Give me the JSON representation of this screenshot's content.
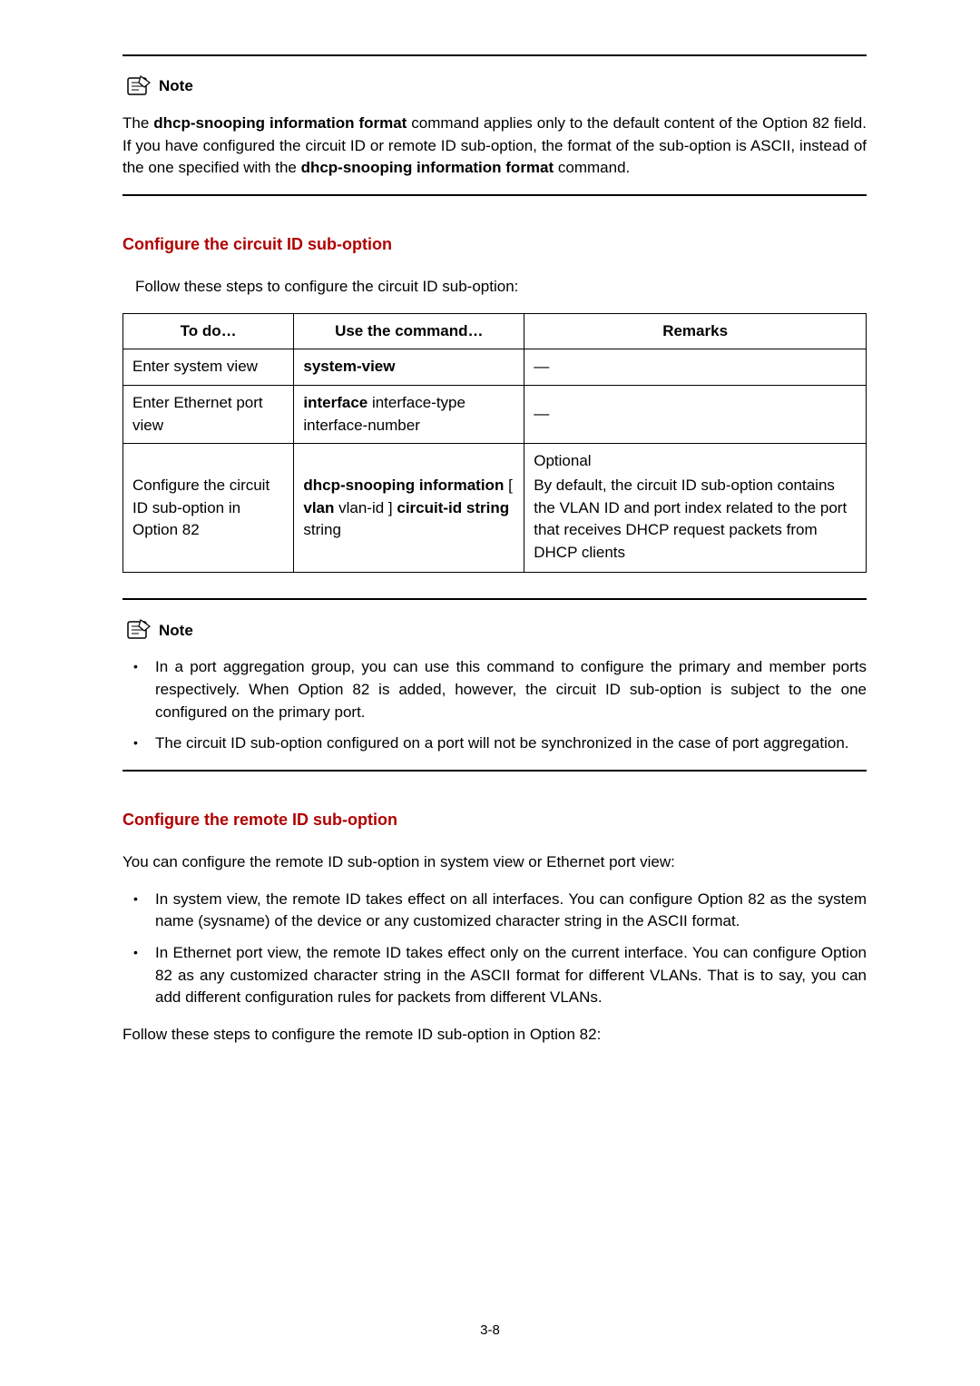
{
  "note1": {
    "label": "Note",
    "para_parts": [
      {
        "t": "The "
      },
      {
        "t": "dhcp-snooping information format",
        "b": true
      },
      {
        "t": " command applies only to the default content of the Option 82 field. If you have configured the circuit ID or remote ID sub-option, the format of the sub-option is ASCII, instead of the one specified with the "
      },
      {
        "t": "dhcp-snooping information format",
        "b": true
      },
      {
        "t": " command."
      }
    ]
  },
  "section1": {
    "title": "Configure the circuit ID sub-option",
    "intro": "Follow these steps to configure the circuit ID sub-option:",
    "table": {
      "headers": [
        "To do…",
        "Use the command…",
        "Remarks"
      ],
      "rows": [
        {
          "todo": "Enter system view",
          "cmd_parts": [
            {
              "t": "system-view",
              "b": true
            }
          ],
          "remarks_parts": [
            {
              "t": "—"
            }
          ]
        },
        {
          "todo": "Enter Ethernet port view",
          "cmd_parts": [
            {
              "t": "interface ",
              "b": true
            },
            {
              "t": "interface-type interface-number"
            }
          ],
          "remarks_parts": [
            {
              "t": "—"
            }
          ]
        },
        {
          "todo": "Configure the circuit ID sub-option in Option 82",
          "cmd_parts": [
            {
              "t": "dhcp-snooping information ",
              "b": true
            },
            {
              "t": "[ "
            },
            {
              "t": "vlan ",
              "b": true
            },
            {
              "t": "vlan-id "
            },
            {
              "t": "] "
            },
            {
              "t": "circuit-id string ",
              "b": true
            },
            {
              "t": "string"
            }
          ],
          "remarks_lines": [
            "Optional",
            "By default, the circuit ID sub-option contains the VLAN ID and port index related to the port that receives DHCP request packets from DHCP clients"
          ]
        }
      ]
    }
  },
  "note2": {
    "label": "Note",
    "items": [
      "In a port aggregation group, you can use this command to configure the primary and member ports respectively. When Option 82 is added, however, the circuit ID sub-option is subject to the one configured on the primary port.",
      "The circuit ID sub-option configured on a port will not be synchronized in the case of port aggregation."
    ]
  },
  "section2": {
    "title": "Configure the remote ID sub-option",
    "intro": "You can configure the remote ID sub-option in system view or Ethernet port view:",
    "items": [
      "In system view, the remote ID takes effect on all interfaces. You can configure Option 82 as the system name (sysname) of the device or any customized character string in the ASCII format.",
      "In Ethernet port view, the remote ID takes effect only on the current interface. You can configure Option 82 as any customized character string in the ASCII format for different VLANs. That is to say, you can add different configuration rules for packets from different VLANs."
    ],
    "follow": "Follow these steps to configure the remote ID sub-option in Option 82:"
  },
  "page_number": "3-8"
}
